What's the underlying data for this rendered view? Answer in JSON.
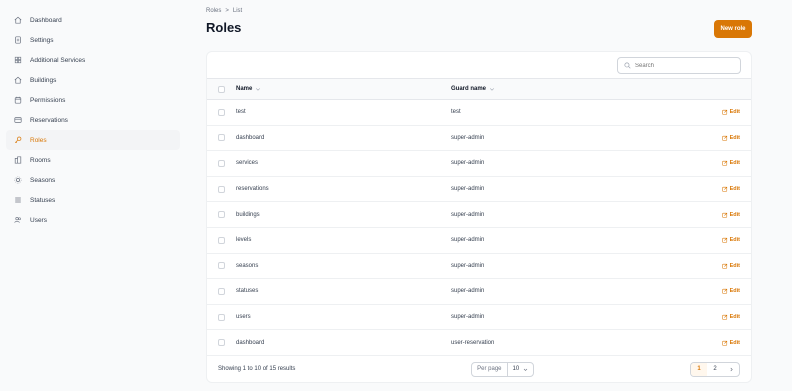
{
  "sidebar": {
    "items": [
      {
        "label": "Dashboard",
        "icon": "home-icon",
        "active": false
      },
      {
        "label": "Settings",
        "icon": "document-icon",
        "active": false
      },
      {
        "label": "Additional Services",
        "icon": "grid-icon",
        "active": false
      },
      {
        "label": "Buildings",
        "icon": "home-icon",
        "active": false
      },
      {
        "label": "Permissions",
        "icon": "calendar-icon",
        "active": false
      },
      {
        "label": "Reservations",
        "icon": "credit-card-icon",
        "active": false
      },
      {
        "label": "Roles",
        "icon": "key-icon",
        "active": true
      },
      {
        "label": "Rooms",
        "icon": "building-icon",
        "active": false
      },
      {
        "label": "Seasons",
        "icon": "sun-icon",
        "active": false
      },
      {
        "label": "Statuses",
        "icon": "list-icon",
        "active": false
      },
      {
        "label": "Users",
        "icon": "users-icon",
        "active": false
      }
    ]
  },
  "header": {
    "breadcrumb": [
      "Roles",
      ">",
      "List"
    ],
    "title": "Roles",
    "new_button": "New role"
  },
  "search": {
    "placeholder": "Search"
  },
  "table": {
    "columns": [
      "Name",
      "Guard name"
    ],
    "edit_label": "Edit",
    "rows": [
      {
        "name": "test",
        "guard": "test"
      },
      {
        "name": "dashboard",
        "guard": "super-admin"
      },
      {
        "name": "services",
        "guard": "super-admin"
      },
      {
        "name": "reservations",
        "guard": "super-admin"
      },
      {
        "name": "buildings",
        "guard": "super-admin"
      },
      {
        "name": "levels",
        "guard": "super-admin"
      },
      {
        "name": "seasons",
        "guard": "super-admin"
      },
      {
        "name": "statuses",
        "guard": "super-admin"
      },
      {
        "name": "users",
        "guard": "super-admin"
      },
      {
        "name": "dashboard",
        "guard": "user-reservation"
      }
    ]
  },
  "footer": {
    "summary": "Showing 1 to 10 of 15 results",
    "per_page_label": "Per page",
    "per_page_value": "10",
    "pages": [
      "1",
      "2"
    ],
    "current_page": "1"
  },
  "colors": {
    "accent": "#d97706",
    "background": "#f9fafb",
    "card": "#ffffff"
  }
}
